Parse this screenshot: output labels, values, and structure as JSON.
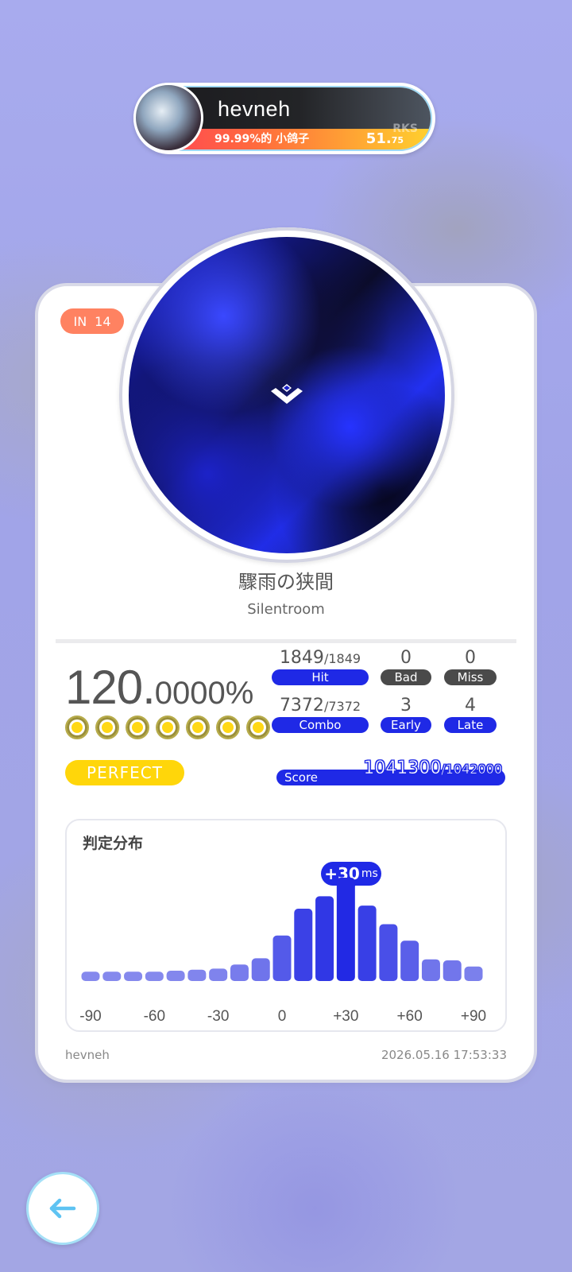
{
  "player": {
    "name": "hevneh",
    "subtitle": "99.99%的 小鸽子",
    "rks_label": "RKS",
    "rks_int": "51.",
    "rks_dec": "75"
  },
  "song": {
    "difficulty": "IN",
    "level": "14",
    "title": "驟雨の狭間",
    "artist": "Silentroom"
  },
  "result": {
    "accuracy_int": "120.",
    "accuracy_dec": "0000%",
    "grade": "PERFECT",
    "dots": 7,
    "hit": "1849",
    "hit_total": "/1849",
    "hit_label": "Hit",
    "bad": "0",
    "bad_label": "Bad",
    "miss": "0",
    "miss_label": "Miss",
    "combo": "7372",
    "combo_total": "/7372",
    "combo_label": "Combo",
    "early": "3",
    "early_label": "Early",
    "late": "4",
    "late_label": "Late",
    "score_label": "Score",
    "score": "1041300",
    "score_max": "/1042000"
  },
  "distribution": {
    "title": "判定分布",
    "peak_value": "+30",
    "peak_unit": "ms",
    "ticks": [
      "-90",
      "-60",
      "-30",
      "0",
      "+30",
      "+60",
      "+90"
    ]
  },
  "chart_data": {
    "type": "bar",
    "title": "判定分布",
    "x": [
      -90,
      -80,
      -70,
      -60,
      -50,
      -40,
      -30,
      -20,
      -10,
      0,
      10,
      20,
      30,
      40,
      50,
      60,
      70,
      80,
      90
    ],
    "values": [
      0.09,
      0.09,
      0.09,
      0.09,
      0.1,
      0.11,
      0.12,
      0.16,
      0.22,
      0.44,
      0.7,
      0.82,
      1.0,
      0.73,
      0.55,
      0.39,
      0.21,
      0.2,
      0.14
    ],
    "peak": 30,
    "colors": {
      "low": "#a3a6f0",
      "high": "#2229e4"
    }
  },
  "footer": {
    "name": "hevneh",
    "date": "2026.05.16 17:53:33"
  }
}
